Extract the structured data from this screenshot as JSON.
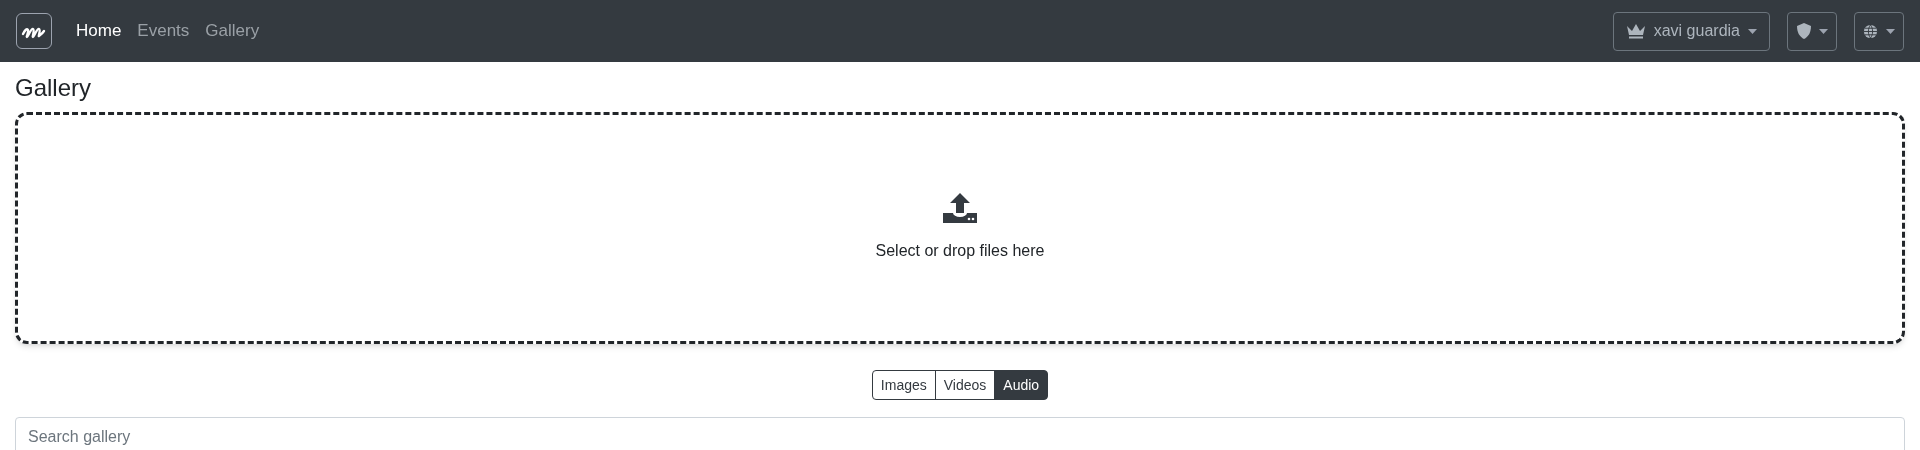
{
  "navbar": {
    "links": [
      {
        "label": "Home",
        "selected": true
      },
      {
        "label": "Events",
        "selected": false
      },
      {
        "label": "Gallery",
        "selected": false
      }
    ],
    "user_menu": {
      "label": "xavi guardia"
    }
  },
  "page": {
    "title": "Gallery"
  },
  "dropzone": {
    "text": "Select or drop files here"
  },
  "filters": [
    {
      "label": "Images",
      "selected": false
    },
    {
      "label": "Videos",
      "selected": false
    },
    {
      "label": "Audio",
      "selected": true
    }
  ],
  "search": {
    "placeholder": "Search gallery"
  }
}
